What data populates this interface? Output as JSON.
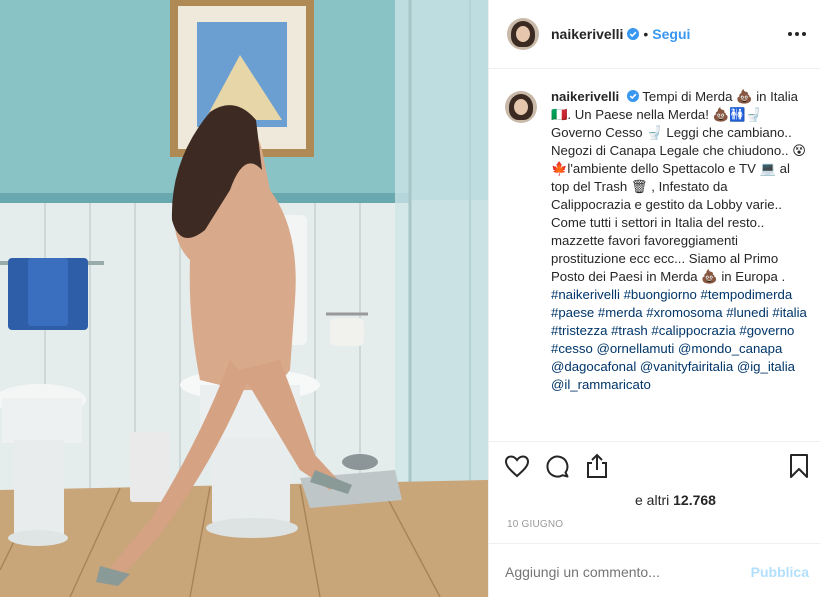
{
  "post": {
    "username": "naikerivelli",
    "dot": "•",
    "follow_label": "Segui",
    "caption": "Tempi di Merda 💩 in Italia 🇮🇹. Un Paese nella Merda! 💩🚻🚽 Governo Cesso 🚽 Leggi che cambiano.. Negozi di Canapa Legale che chiudono.. 😵🍁l'ambiente dello Spettacolo e TV 💻 al top del Trash 🗑 , Infestato da Calippocrazia e gestito da Lobby varie.. Come tutti i settori in Italia del resto.. mazzette favori favoreggiamenti prostituzione ecc ecc... Siamo al Primo Posto dei Paesi in Merda 💩 in Europa . ",
    "hashtags": "#naikerivelli #buongiorno #tempodimerda #paese #merda #xromosoma #lunedi #italia #tristezza #trash #calippocrazia #governo #cesso @ornellamuti @mondo_canapa @dagocafonal @vanityfairitalia @ig_italia @il_rammaricato",
    "likes_prefix": "e altri ",
    "likes_count": "12.768",
    "date": "10 GIUGNO",
    "comment_placeholder": "Aggiungi un commento...",
    "publish_label": "Pubblica"
  },
  "icons": {
    "like": "heart-outline-icon",
    "comment": "speech-bubble-icon",
    "share": "share-arrow-icon",
    "save": "bookmark-icon",
    "more": "three-dots-icon",
    "verified": "verified-badge-icon"
  },
  "colors": {
    "link": "#3897f0",
    "hashtag": "#003569",
    "publish_disabled": "#b2dffc",
    "verified": "#3897f0"
  }
}
